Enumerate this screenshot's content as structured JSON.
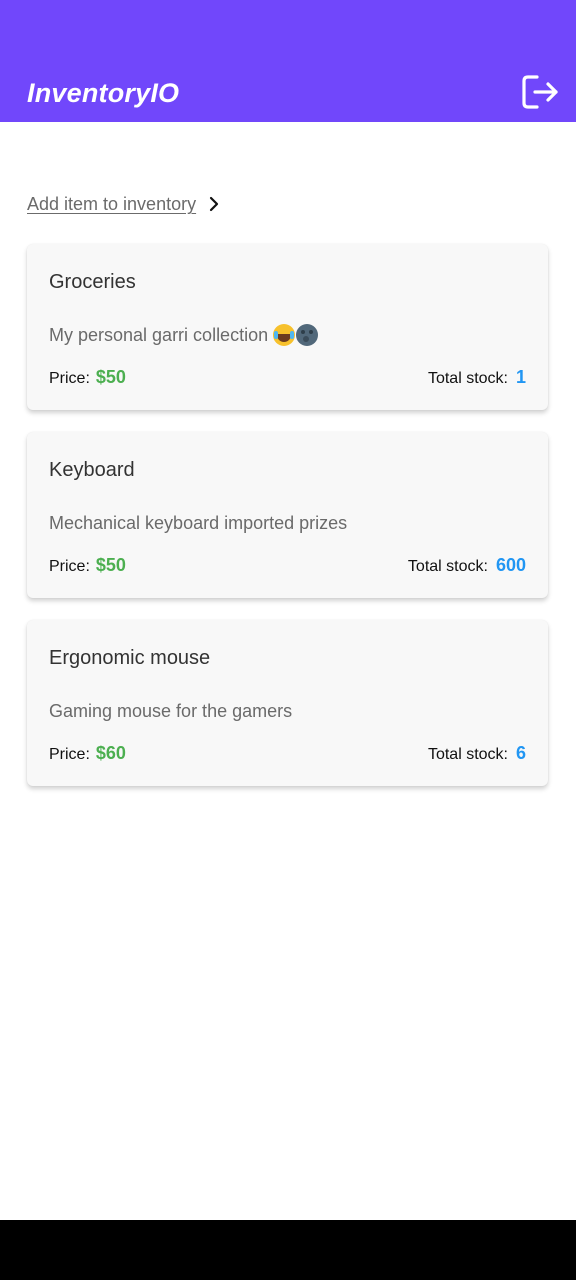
{
  "header": {
    "title": "InventoryIO",
    "logout_icon": "logout-icon",
    "background": "#7147FB"
  },
  "add_item": {
    "label": "Add item to inventory",
    "icon": "chevron-right-icon"
  },
  "labels": {
    "price": "Price:",
    "total_stock": "Total stock:"
  },
  "items": [
    {
      "title": "Groceries",
      "description": "My personal garri collection",
      "emojis": [
        "face-with-tears-of-joy",
        "new-moon-face"
      ],
      "price": "$50",
      "stock": "1"
    },
    {
      "title": "Keyboard",
      "description": "Mechanical keyboard imported prizes",
      "price": "$50",
      "stock": "600"
    },
    {
      "title": "Ergonomic mouse",
      "description": "Gaming mouse for the gamers",
      "price": "$60",
      "stock": "6"
    }
  ],
  "colors": {
    "accent": "#7147FB",
    "price": "#4CAF50",
    "stock": "#2196F3"
  }
}
